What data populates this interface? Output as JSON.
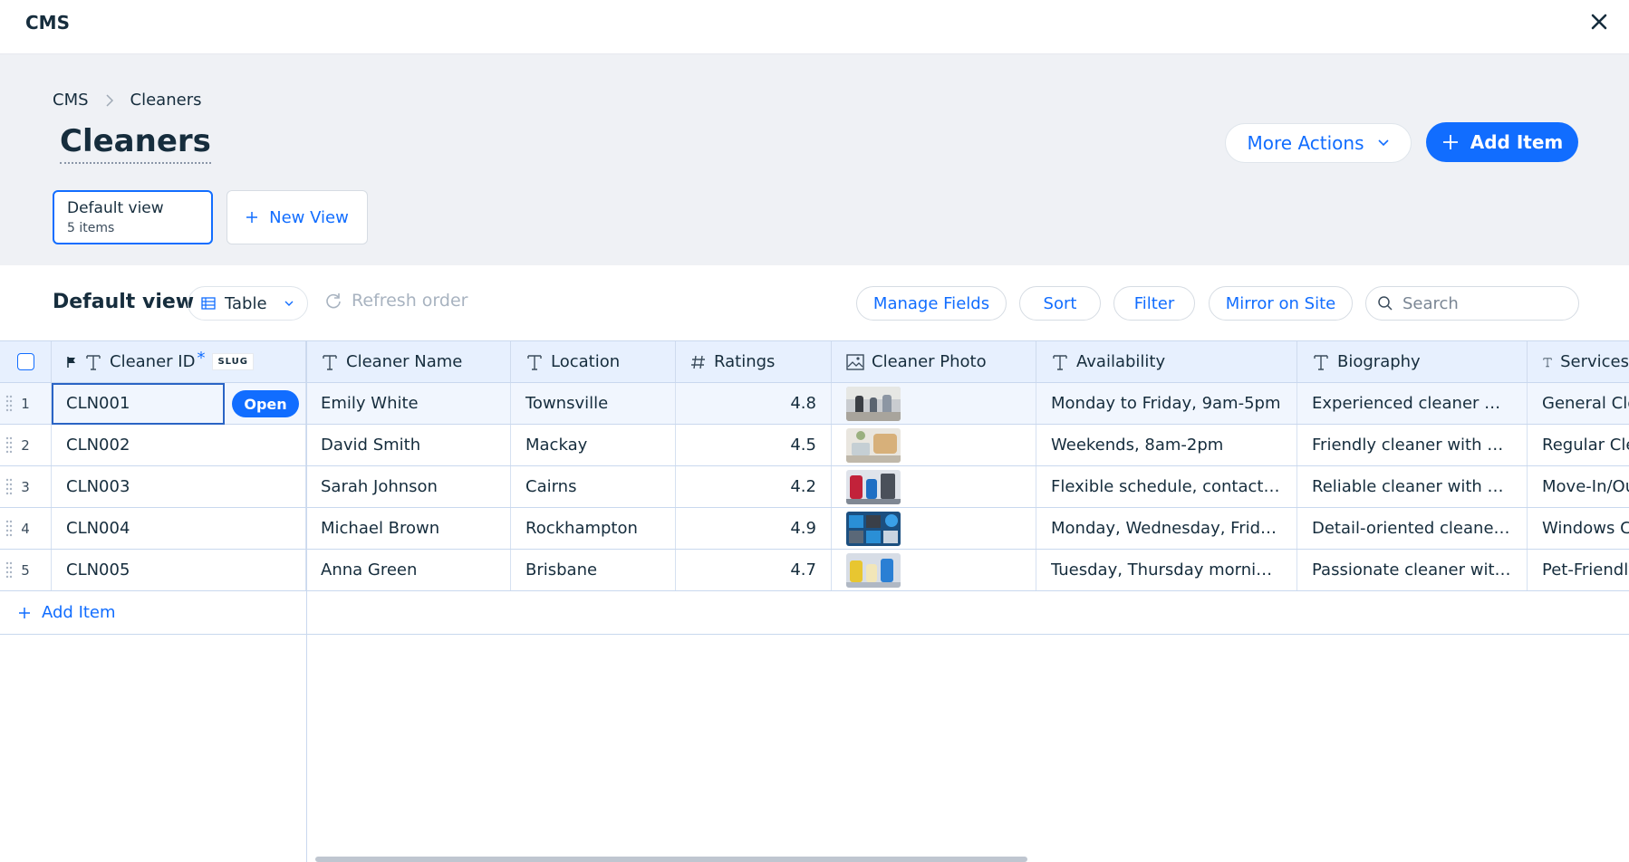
{
  "app": {
    "title": "CMS"
  },
  "header": {
    "breadcrumb": [
      "CMS",
      "Cleaners"
    ],
    "title": "Cleaners",
    "more_actions": "More Actions",
    "add_item": "Add Item"
  },
  "views": {
    "active": {
      "name": "Default view",
      "count": "5 items"
    },
    "new_view": "New View"
  },
  "toolbar": {
    "title": "Default view",
    "layout": "Table",
    "refresh": "Refresh order",
    "manage_fields": "Manage Fields",
    "sort": "Sort",
    "filter": "Filter",
    "mirror": "Mirror on Site",
    "search_placeholder": "Search"
  },
  "table": {
    "columns": [
      "Cleaner ID",
      "Cleaner Name",
      "Location",
      "Ratings",
      "Cleaner Photo",
      "Availability",
      "Biography",
      "Services"
    ],
    "slug_badge": "SLUG",
    "required_mark": "*",
    "open_label": "Open",
    "rows": [
      {
        "index": "1",
        "id": "CLN001",
        "name": "Emily White",
        "location": "Townsville",
        "rating": "4.8",
        "availability": "Monday to Friday, 9am-5pm",
        "biography": "Experienced cleaner with…",
        "services": "General Cleaning"
      },
      {
        "index": "2",
        "id": "CLN002",
        "name": "David Smith",
        "location": "Mackay",
        "rating": "4.5",
        "availability": "Weekends, 8am-2pm",
        "biography": "Friendly cleaner with eco…",
        "services": "Regular Cleaning"
      },
      {
        "index": "3",
        "id": "CLN003",
        "name": "Sarah Johnson",
        "location": "Cairns",
        "rating": "4.2",
        "availability": "Flexible schedule, contact for…",
        "biography": "Reliable cleaner with pos…",
        "services": "Move-In/Out"
      },
      {
        "index": "4",
        "id": "CLN004",
        "name": "Michael Brown",
        "location": "Rockhampton",
        "rating": "4.9",
        "availability": "Monday, Wednesday, Friday …",
        "biography": "Detail-oriented cleaner w…",
        "services": "Windows Cleaning"
      },
      {
        "index": "5",
        "id": "CLN005",
        "name": "Anna Green",
        "location": "Brisbane",
        "rating": "4.7",
        "availability": "Tuesday, Thursday mornings",
        "biography": "Passionate cleaner with a…",
        "services": "Pet-Friendly"
      }
    ],
    "add_item": "Add Item"
  },
  "colors": {
    "accent": "#116dff",
    "header_bg": "#eff1f5",
    "table_header_bg": "#e7f0fe"
  }
}
